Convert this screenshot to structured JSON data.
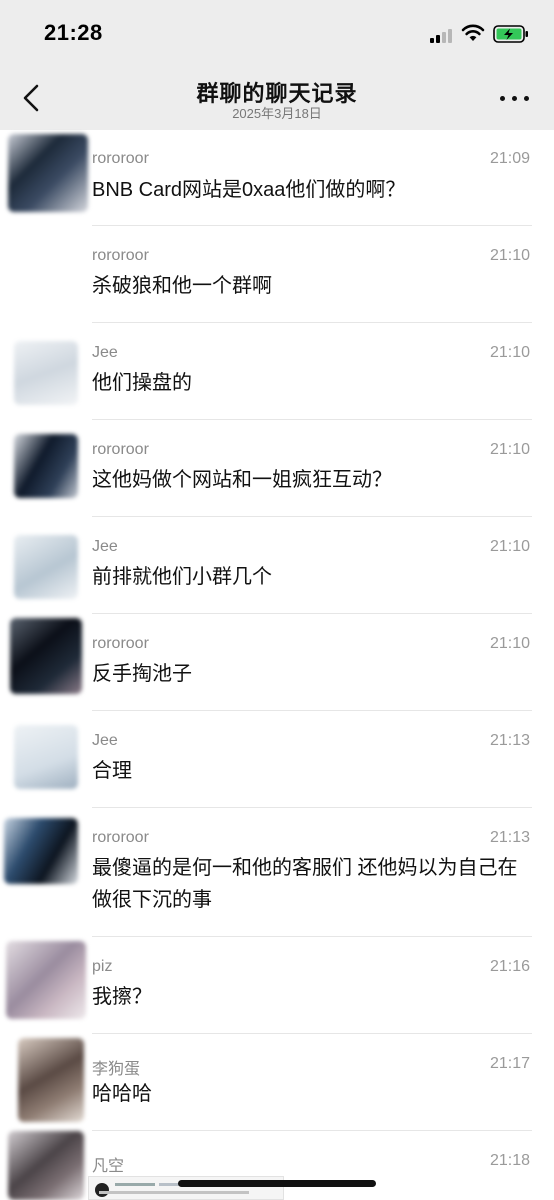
{
  "status_bar": {
    "time": "21:28"
  },
  "header": {
    "title": "群聊的聊天记录",
    "subtitle": "2025年3月18日"
  },
  "messages": [
    {
      "sender": "rororoor",
      "time": "21:09",
      "text": "BNB Card网站是0xaa他们做的啊？"
    },
    {
      "sender": "rororoor",
      "time": "21:10",
      "text": "杀破狼和他一个群啊"
    },
    {
      "sender": "Jee",
      "time": "21:10",
      "text": "他们操盘的"
    },
    {
      "sender": "rororoor",
      "time": "21:10",
      "text": "这他妈做个网站和一姐疯狂互动？"
    },
    {
      "sender": "Jee",
      "time": "21:10",
      "text": "前排就他们小群几个"
    },
    {
      "sender": "rororoor",
      "time": "21:10",
      "text": "反手掏池子"
    },
    {
      "sender": "Jee",
      "time": "21:13",
      "text": "合理"
    },
    {
      "sender": "rororoor",
      "time": "21:13",
      "text": "最傻逼的是何一和他的客服们 还他妈以为自己在做很下沉的事"
    },
    {
      "sender": "piz",
      "time": "21:16",
      "text": "我擦？"
    },
    {
      "sender": "李狗蛋",
      "time": "21:17",
      "text": "哈哈哈"
    },
    {
      "sender": "凡空",
      "time": "21:18",
      "text": ""
    }
  ]
}
